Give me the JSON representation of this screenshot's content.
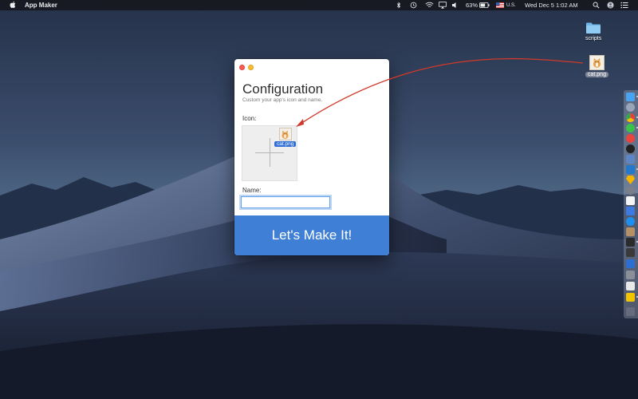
{
  "menubar": {
    "app_name": "App Maker",
    "battery": "63%",
    "input_source": "U.S.",
    "clock": "Wed Dec 5  1:02 AM",
    "icons": [
      "apple-icon",
      "bluetooth-icon",
      "time-machine-icon",
      "wifi-icon",
      "airplay-icon",
      "volume-icon",
      "battery-icon",
      "flag-icon",
      "search-icon",
      "user-icon",
      "notification-center-icon"
    ]
  },
  "desktop": {
    "folder_label": "scripts",
    "file_label": "cat.png"
  },
  "window": {
    "title": "Configuration",
    "subtitle": "Custom your app's icon and name.",
    "icon_label": "Icon:",
    "drag_ghost_label": "cat.png",
    "name_label": "Name:",
    "name_value": "",
    "make_button_label": "Let's Make It!"
  },
  "dock": {
    "items": [
      "finder-icon",
      "launchpad-icon",
      "chrome-icon",
      "wechat-icon",
      "weibo-icon",
      "qq-icon",
      "preview-icon",
      "vscode-icon",
      "sketch-icon",
      "alfred-icon",
      "textedit-icon",
      "maps-icon",
      "app-store-icon",
      "photos-icon",
      "terminal-icon",
      "activity-monitor-icon",
      "system-preferences-icon",
      "finder-window-icon",
      "script-editor-icon",
      "console-icon",
      "trash-icon"
    ]
  },
  "colors": {
    "accent": "#3f7fd6",
    "arrow": "#d03a2a",
    "close": "#fd5d55",
    "minimize": "#febb2f"
  }
}
